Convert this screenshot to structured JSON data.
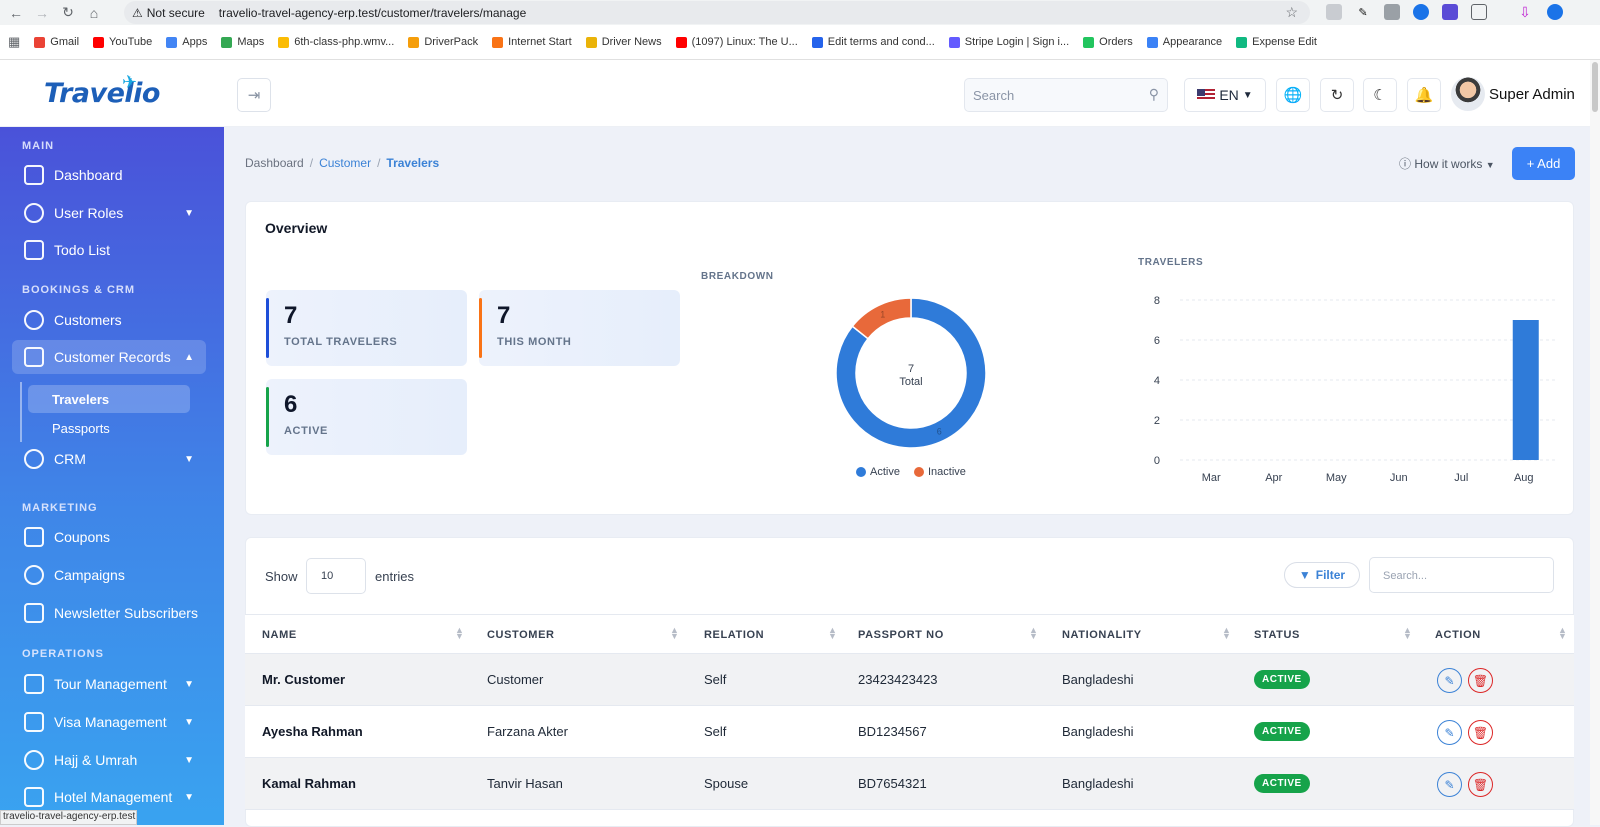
{
  "browser": {
    "security_label": "Not secure",
    "url": "travelio-travel-agency-erp.test/customer/travelers/manage",
    "status_url": "travelio-travel-agency-erp.test",
    "bookmarks": [
      {
        "label": "Gmail",
        "color": "#ea4335"
      },
      {
        "label": "YouTube",
        "color": "#ff0000"
      },
      {
        "label": "Apps",
        "color": "#4285f4"
      },
      {
        "label": "Maps",
        "color": "#34a853"
      },
      {
        "label": "6th-class-php.wmv...",
        "color": "#fbbc04"
      },
      {
        "label": "DriverPack",
        "color": "#f59e0b"
      },
      {
        "label": "Internet Start",
        "color": "#f97316"
      },
      {
        "label": "Driver News",
        "color": "#eab308"
      },
      {
        "label": "(1097) Linux: The U...",
        "color": "#ff0000"
      },
      {
        "label": "Edit terms and cond...",
        "color": "#2563eb"
      },
      {
        "label": "Stripe Login | Sign i...",
        "color": "#635bff"
      },
      {
        "label": "Orders",
        "color": "#22c55e"
      },
      {
        "label": "Appearance",
        "color": "#3b82f6"
      },
      {
        "label": "Expense Edit",
        "color": "#10b981"
      }
    ]
  },
  "header": {
    "logo": "Travelio",
    "search_placeholder": "Search",
    "language": "EN",
    "user_name": "Super Admin"
  },
  "sidebar": {
    "sections": {
      "main": "MAIN",
      "bookings": "BOOKINGS & CRM",
      "marketing": "MARKETING",
      "operations": "OPERATIONS"
    },
    "items": {
      "dashboard": "Dashboard",
      "user_roles": "User Roles",
      "todo": "Todo List",
      "customers": "Customers",
      "customer_records": "Customer Records",
      "travelers": "Travelers",
      "passports": "Passports",
      "crm": "CRM",
      "coupons": "Coupons",
      "campaigns": "Campaigns",
      "newsletter": "Newsletter Subscribers",
      "tour": "Tour Management",
      "visa": "Visa Management",
      "hajj": "Hajj & Umrah",
      "hotel": "Hotel Management"
    }
  },
  "breadcrumb": {
    "home": "Dashboard",
    "parent": "Customer",
    "current": "Travelers"
  },
  "page_actions": {
    "how": "How it works",
    "add": "+ Add"
  },
  "overview": {
    "title": "Overview",
    "stats": [
      {
        "value": "7",
        "label": "TOTAL TRAVELERS",
        "color": "#1d4ed8"
      },
      {
        "value": "7",
        "label": "THIS MONTH",
        "color": "#f97316"
      },
      {
        "value": "6",
        "label": "ACTIVE",
        "color": "#16a34a"
      }
    ],
    "breakdown_title": "BREAKDOWN",
    "travelers_title": "TRAVELERS"
  },
  "chart_data": [
    {
      "type": "pie",
      "title": "BREAKDOWN",
      "center_value": "7",
      "center_label": "Total",
      "slices": [
        {
          "label": "Active",
          "value": 6,
          "color": "#2f7bd9"
        },
        {
          "label": "Inactive",
          "value": 1,
          "color": "#e8693a"
        }
      ]
    },
    {
      "type": "bar",
      "title": "TRAVELERS",
      "categories": [
        "Mar",
        "Apr",
        "May",
        "Jun",
        "Jul",
        "Aug"
      ],
      "values": [
        0,
        0,
        0,
        0,
        0,
        7
      ],
      "yticks": [
        "0",
        "2",
        "4",
        "6",
        "8"
      ],
      "ylim": [
        0,
        8
      ],
      "color": "#2f7bd9"
    }
  ],
  "table": {
    "show_label": "Show",
    "entries_value": "10",
    "entries_label": "entries",
    "filter_label": "Filter",
    "search_placeholder": "Search...",
    "columns": [
      "NAME",
      "CUSTOMER",
      "RELATION",
      "PASSPORT NO",
      "NATIONALITY",
      "STATUS",
      "ACTION"
    ],
    "rows": [
      {
        "name": "Mr. Customer",
        "customer": "Customer",
        "relation": "Self",
        "passport": "23423423423",
        "nationality": "Bangladeshi",
        "status": "ACTIVE"
      },
      {
        "name": "Ayesha Rahman",
        "customer": "Farzana Akter",
        "relation": "Self",
        "passport": "BD1234567",
        "nationality": "Bangladeshi",
        "status": "ACTIVE"
      },
      {
        "name": "Kamal Rahman",
        "customer": "Tanvir Hasan",
        "relation": "Spouse",
        "passport": "BD7654321",
        "nationality": "Bangladeshi",
        "status": "ACTIVE"
      }
    ]
  }
}
